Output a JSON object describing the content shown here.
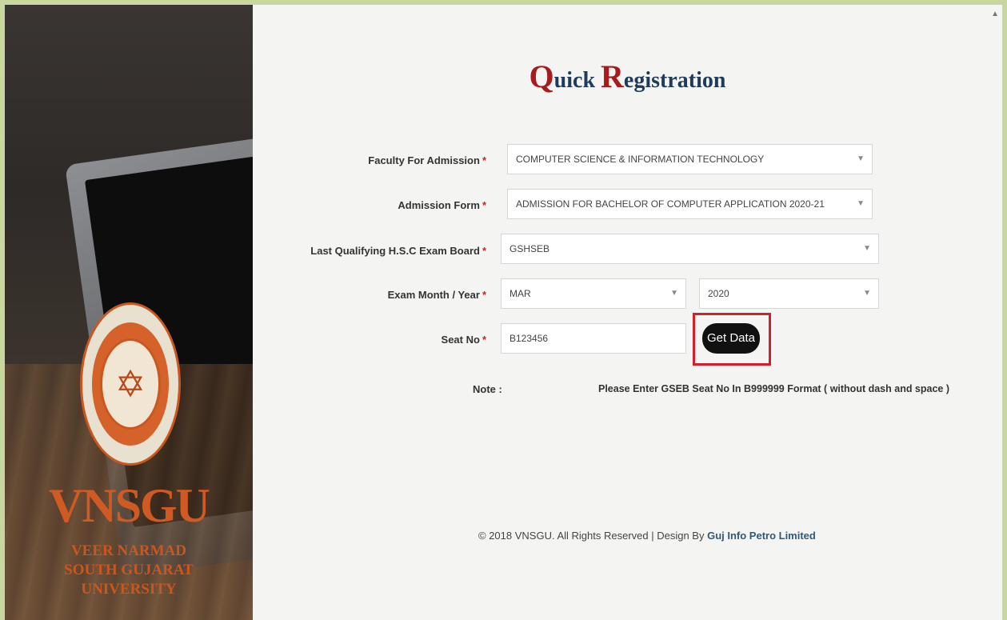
{
  "page": {
    "title_cap_1": "Q",
    "title_rest_1": "uick ",
    "title_cap_2": "R",
    "title_rest_2": "egistration"
  },
  "sidebar": {
    "logo_icon": "vnsgu-seal",
    "brand": "VNSGU",
    "brand_line_1": "VEER NARMAD",
    "brand_line_2": "SOUTH GUJARAT",
    "brand_line_3": "UNIVERSITY"
  },
  "form": {
    "required_mark": "*",
    "faculty": {
      "label": "Faculty For Admission",
      "value": "COMPUTER SCIENCE & INFORMATION TECHNOLOGY"
    },
    "admission_form": {
      "label": "Admission Form",
      "value": "ADMISSION FOR BACHELOR OF COMPUTER APPLICATION 2020-21"
    },
    "exam_board": {
      "label": "Last Qualifying H.S.C Exam Board",
      "value": "GSHSEB"
    },
    "exam_month_year": {
      "label": "Exam Month / Year",
      "month": "MAR",
      "year": "2020"
    },
    "seat_no": {
      "label": "Seat No",
      "value": "B123456"
    },
    "get_data_label": "Get Data",
    "note_label": "Note :",
    "note_text": "Please Enter GSEB Seat No In B999999 Format ( without dash and space )"
  },
  "footer": {
    "text": "© 2018 VNSGU. All Rights Reserved | Design By ",
    "link": "Guj Info Petro Limited"
  },
  "colors": {
    "title_cap": "#a61c1c",
    "title": "#1f3b5c",
    "required": "#c0262d",
    "highlight_box": "#d21f2c",
    "brand": "#d05a24"
  }
}
